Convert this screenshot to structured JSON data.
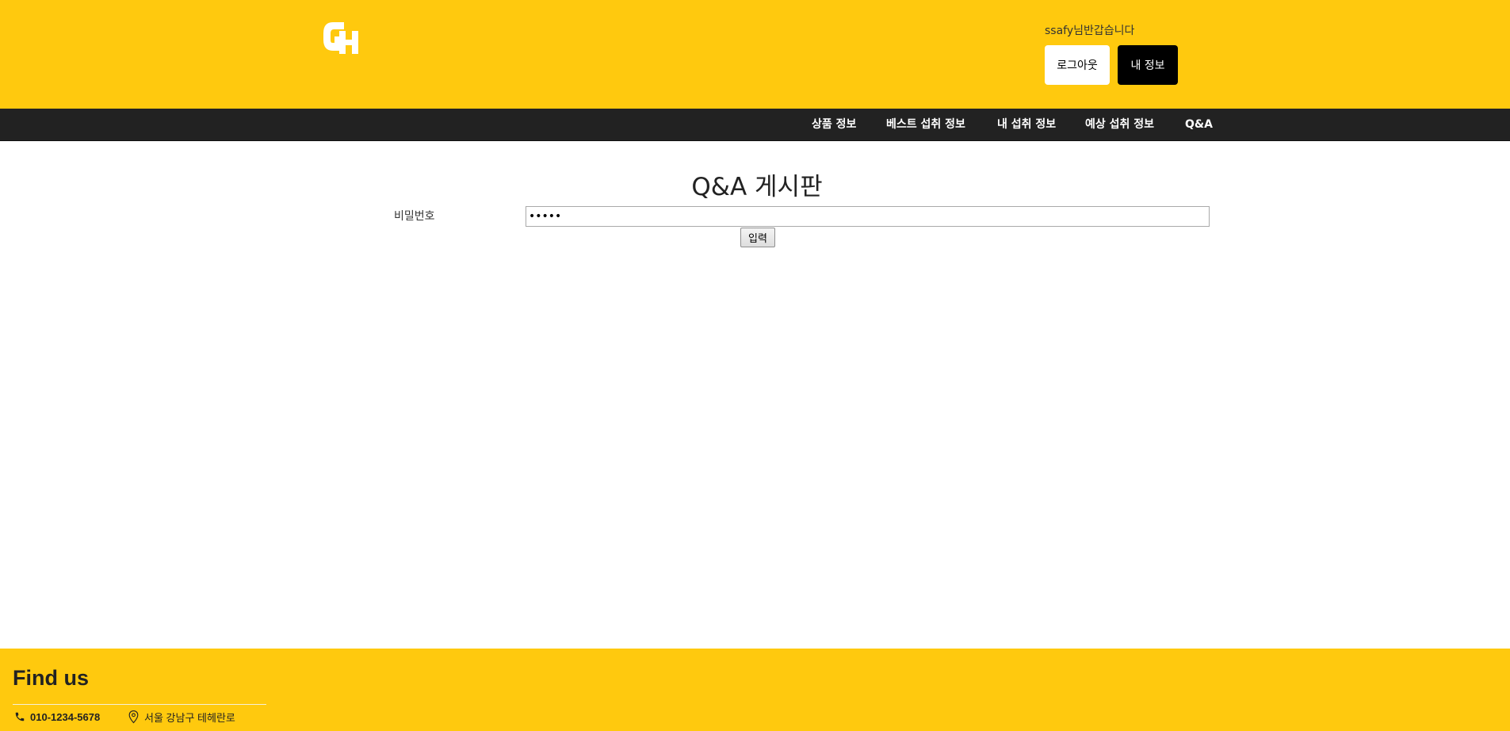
{
  "header": {
    "logo_text": "GH",
    "greeting": "ssafy님반갑습니다",
    "logout_label": "로그아웃",
    "myinfo_label": "내 정보"
  },
  "nav": {
    "items": [
      {
        "label": "상품 정보"
      },
      {
        "label": "베스트 섭취 정보"
      },
      {
        "label": "내 섭취 정보"
      },
      {
        "label": "예상 섭취 정보"
      },
      {
        "label": "Q&A"
      }
    ]
  },
  "main": {
    "title": "Q&A 게시판",
    "password_label": "비밀번호",
    "password_value": "*****",
    "submit_label": "입력"
  },
  "footer": {
    "title": "Find us",
    "phone": "010-1234-5678",
    "address": "서울 강남구 테헤란로"
  },
  "colors": {
    "brand_yellow": "#ffc90e",
    "nav_dark": "#222222"
  },
  "icons": {
    "phone": "phone-icon",
    "location": "location-pin-icon"
  }
}
